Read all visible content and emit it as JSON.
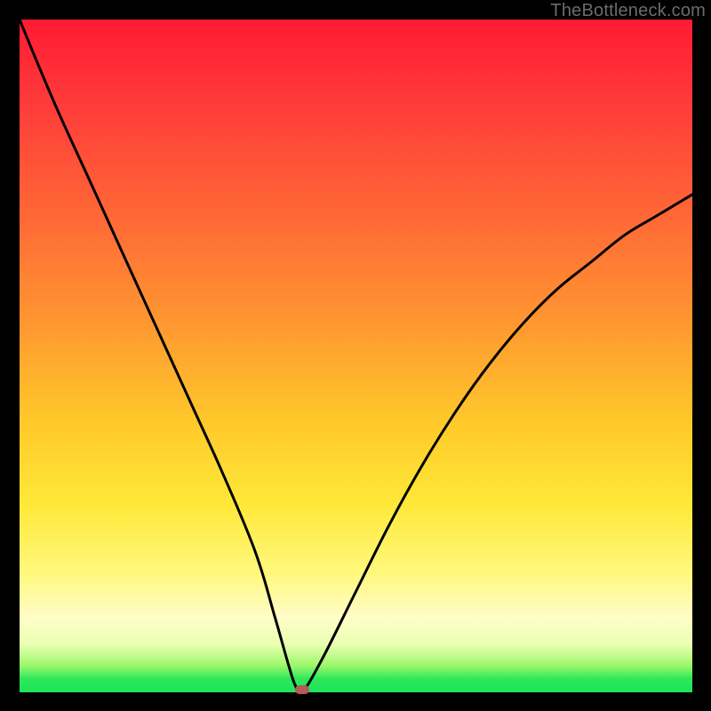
{
  "watermark": "TheBottleneck.com",
  "chart_data": {
    "type": "line",
    "title": "",
    "xlabel": "",
    "ylabel": "",
    "xlim": [
      0,
      100
    ],
    "ylim": [
      0,
      100
    ],
    "grid": false,
    "legend": false,
    "annotations": [],
    "series": [
      {
        "name": "curve",
        "x": [
          0,
          5,
          10,
          15,
          20,
          25,
          30,
          35,
          38,
          40,
          41,
          42,
          45,
          50,
          55,
          60,
          65,
          70,
          75,
          80,
          85,
          90,
          95,
          100
        ],
        "values": [
          100,
          88,
          77,
          66,
          55,
          44,
          33,
          21,
          11,
          4,
          1,
          0,
          5,
          15,
          25,
          34,
          42,
          49,
          55,
          60,
          64,
          68,
          71,
          74
        ]
      }
    ],
    "marker": {
      "x": 42,
      "y": 0
    },
    "gradient_stops": [
      {
        "pos": 0,
        "color": "#ff1a33"
      },
      {
        "pos": 12,
        "color": "#ff3a3a"
      },
      {
        "pos": 30,
        "color": "#ff6a36"
      },
      {
        "pos": 46,
        "color": "#ff9a30"
      },
      {
        "pos": 60,
        "color": "#ffc92a"
      },
      {
        "pos": 72,
        "color": "#ffe838"
      },
      {
        "pos": 82,
        "color": "#fff87a"
      },
      {
        "pos": 89,
        "color": "#fffdc8"
      },
      {
        "pos": 93,
        "color": "#e8ffb0"
      },
      {
        "pos": 96,
        "color": "#9cf76a"
      },
      {
        "pos": 98,
        "color": "#2ee85a"
      },
      {
        "pos": 100,
        "color": "#1de35a"
      }
    ]
  }
}
